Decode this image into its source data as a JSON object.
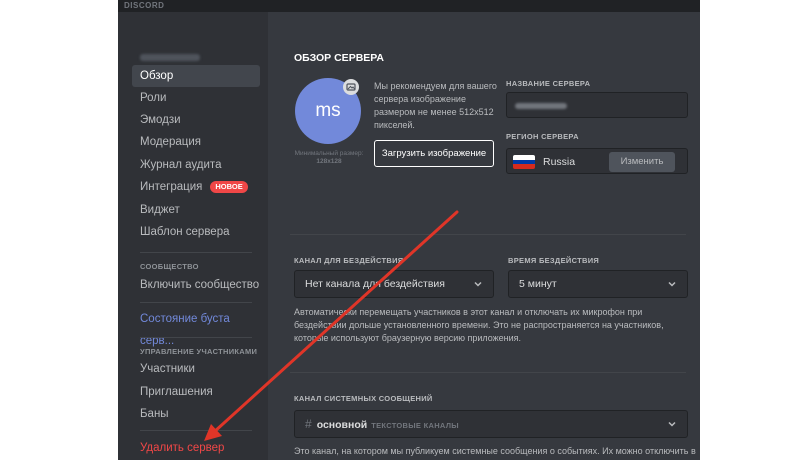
{
  "app": {
    "brand": "DISCORD"
  },
  "sidebar": {
    "items": [
      {
        "label": "Обзор"
      },
      {
        "label": "Роли"
      },
      {
        "label": "Эмодзи"
      },
      {
        "label": "Модерация"
      },
      {
        "label": "Журнал аудита"
      },
      {
        "label": "Интеграция",
        "badge": "НОВОЕ"
      },
      {
        "label": "Виджет"
      },
      {
        "label": "Шаблон сервера"
      }
    ],
    "community_section": "СООБЩЕСТВО",
    "enable_community": "Включить сообщество",
    "boost_status": "Состояние буста серв...",
    "members_section": "УПРАВЛЕНИЕ УЧАСТНИКАМИ",
    "member_items": [
      {
        "label": "Участники"
      },
      {
        "label": "Приглашения"
      },
      {
        "label": "Баны"
      }
    ],
    "delete_server": "Удалить сервер"
  },
  "overview": {
    "title": "ОБЗОР СЕРВЕРА",
    "avatar_initials": "ms",
    "min_size_label": "Минимальный размер:",
    "min_size_value": "128x128",
    "recommendation": "Мы рекомендуем для вашего сервера изображение размером не менее 512x512 пикселей.",
    "upload_button": "Загрузить изображение",
    "server_name_label": "НАЗВАНИЕ СЕРВЕРА",
    "server_region_label": "РЕГИОН СЕРВЕРА",
    "region_value": "Russia",
    "change_button": "Изменить"
  },
  "afk": {
    "channel_label": "КАНАЛ ДЛЯ БЕЗДЕЙСТВИЯ",
    "channel_value": "Нет канала для бездействия",
    "timeout_label": "ВРЕМЯ БЕЗДЕЙСТВИЯ",
    "timeout_value": "5 минут",
    "description": "Автоматически перемещать участников в этот канал и отключать их микрофон при бездействии дольше установленного времени. Это не распространяется на участников, которые используют браузерную версию приложения."
  },
  "system": {
    "label": "КАНАЛ СИСТЕМНЫХ СООБЩЕНИЙ",
    "channel_name": "основной",
    "channel_category": "ТЕКСТОВЫЕ КАНАЛЫ",
    "description": "Это канал, на котором мы публикуем системные сообщения о событиях. Их можно отключить в"
  },
  "colors": {
    "sidebar_bg": "#2f3136",
    "content_bg": "#36393f",
    "accent": "#7289da",
    "danger": "#f04747",
    "annotation_arrow": "#e03528"
  }
}
